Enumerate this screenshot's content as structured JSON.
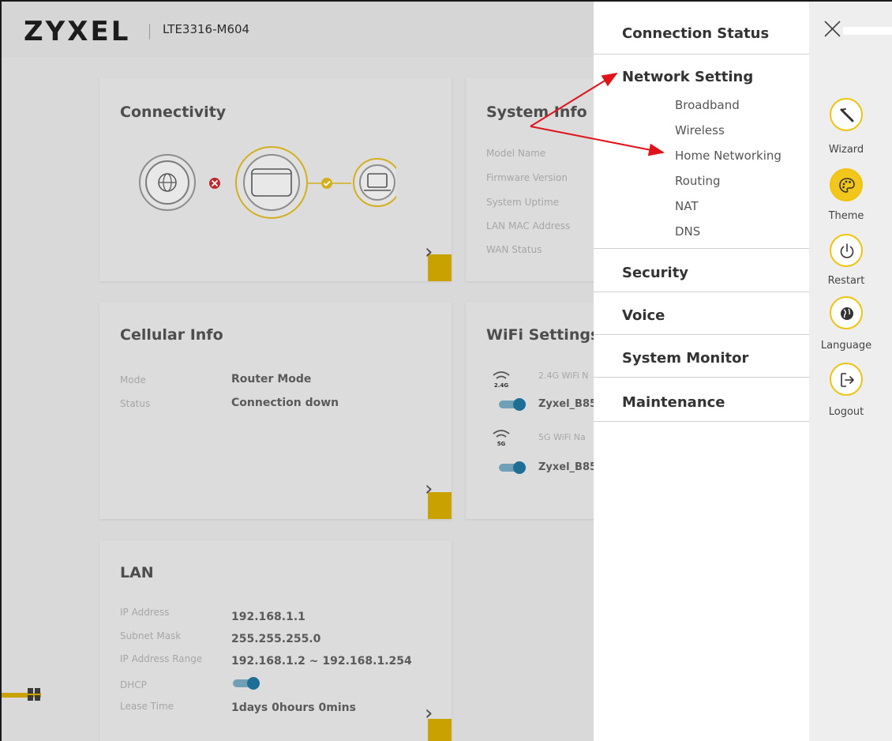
{
  "header": {
    "brand": "ZYXEL",
    "model": "LTE3316-M604"
  },
  "cards": {
    "connectivity": {
      "title": "Connectivity"
    },
    "system_info": {
      "title": "System Info",
      "labels": [
        "Model Name",
        "Firmware Version",
        "System Uptime",
        "LAN MAC Address",
        "WAN Status"
      ]
    },
    "cellular": {
      "title": "Cellular Info",
      "rows": [
        {
          "label": "Mode",
          "value": "Router Mode"
        },
        {
          "label": "Status",
          "value": "Connection down"
        }
      ]
    },
    "wifi": {
      "title": "WiFi Settings",
      "bands": [
        {
          "badge": "2.4G",
          "label": "2.4G WiFi N",
          "ssid": "Zyxel_B85"
        },
        {
          "badge": "5G",
          "label": "5G WiFi Na",
          "ssid": "Zyxel_B85"
        }
      ]
    },
    "lan": {
      "title": "LAN",
      "rows": [
        {
          "label": "IP Address",
          "value": "192.168.1.1"
        },
        {
          "label": "Subnet Mask",
          "value": "255.255.255.0"
        },
        {
          "label": "IP Address Range",
          "value": "192.168.1.2 ~ 192.168.1.254"
        },
        {
          "label": "DHCP",
          "value": ""
        },
        {
          "label": "Lease Time",
          "value": "1days 0hours 0mins"
        }
      ]
    }
  },
  "menu": {
    "connection_status": "Connection Status",
    "network_setting": "Network Setting",
    "network_items": [
      "Broadband",
      "Wireless",
      "Home Networking",
      "Routing",
      "NAT",
      "DNS"
    ],
    "security": "Security",
    "voice": "Voice",
    "system_monitor": "System Monitor",
    "maintenance": "Maintenance"
  },
  "rail": {
    "wizard": "Wizard",
    "theme": "Theme",
    "restart": "Restart",
    "language": "Language",
    "logout": "Logout"
  },
  "colors": {
    "accent": "#f3c61b",
    "annotation_arrow": "#e0121a",
    "dim_bg": "#d9d9d9"
  }
}
